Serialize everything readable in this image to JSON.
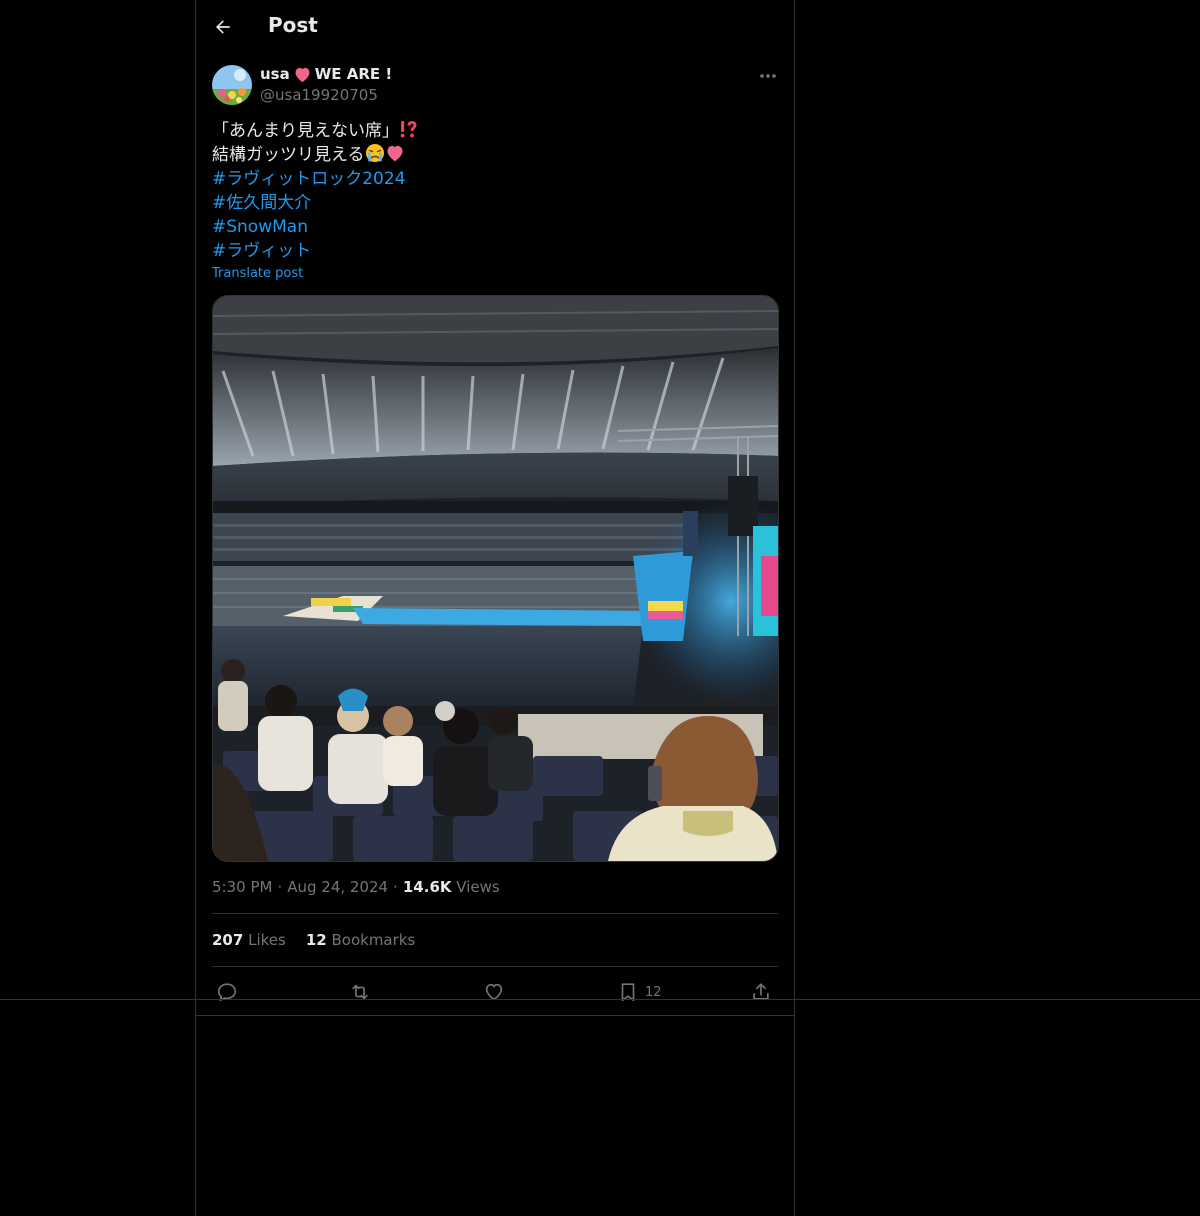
{
  "header": {
    "title": "Post"
  },
  "author": {
    "display_name": "usa",
    "name_suffix": "WE ARE !",
    "handle": "@usa19920705"
  },
  "post": {
    "lines": [
      "「あんまり見えない席」",
      "結構ガッツリ見える"
    ],
    "hashtags": [
      "#ラヴィットロック2024",
      "#佐久間大介",
      "#SnowMan",
      "#ラヴィット"
    ],
    "translate_label": "Translate post",
    "time": "5:30 PM",
    "date": "Aug 24, 2024",
    "views_count": "14.6K",
    "views_label": "Views",
    "separator": "·"
  },
  "stats": {
    "likes_count": "207",
    "likes_label": "Likes",
    "bookmarks_count": "12",
    "bookmarks_label": "Bookmarks"
  },
  "actions": {
    "bookmark_count": "12"
  },
  "icons": {
    "back": "arrow-left-icon",
    "more": "more-horizontal-icon",
    "reply": "reply-icon",
    "repost": "repost-icon",
    "like": "heart-icon",
    "bookmark": "bookmark-icon",
    "share": "share-icon"
  },
  "colors": {
    "background": "#000000",
    "text": "#e7e9ea",
    "secondary": "#71767b",
    "accent": "#1d9bf0",
    "border": "#2f3336"
  }
}
